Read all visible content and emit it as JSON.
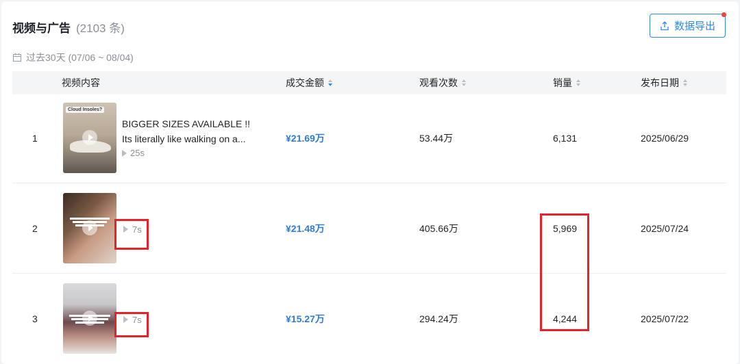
{
  "header": {
    "title": "视频与广告",
    "count": "(2103 条)",
    "export_label": "数据导出",
    "date_range": "过去30天 (07/06 ~ 08/04)"
  },
  "columns": {
    "content": "视频内容",
    "amount": "成交金额",
    "views": "观看次数",
    "sales": "销量",
    "date": "发布日期"
  },
  "rows": [
    {
      "rank": "1",
      "thumb_tag": "Cloud Insoles?",
      "title": "BIGGER SIZES AVAILABLE !!",
      "subtitle": "Its literally like walking on a...",
      "duration": "25s",
      "amount": "¥21.69万",
      "views": "53.44万",
      "sales": "6,131",
      "date": "2025/06/29"
    },
    {
      "rank": "2",
      "duration": "7s",
      "amount": "¥21.48万",
      "views": "405.66万",
      "sales": "5,969",
      "date": "2025/07/24"
    },
    {
      "rank": "3",
      "duration": "7s",
      "amount": "¥15.27万",
      "views": "294.24万",
      "sales": "4,244",
      "date": "2025/07/22"
    }
  ],
  "colors": {
    "accent": "#2f88e8",
    "highlight": "#e8202a"
  }
}
